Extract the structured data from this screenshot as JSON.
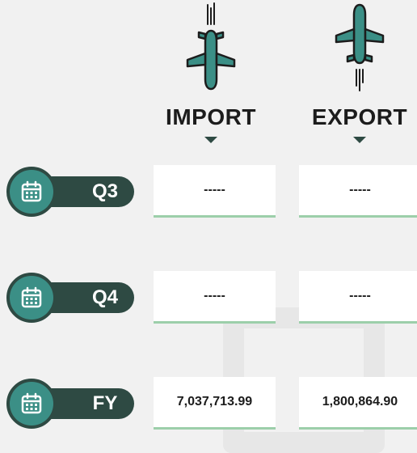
{
  "columns": [
    {
      "label": "IMPORT",
      "icon": "plane-landing-icon"
    },
    {
      "label": "EXPORT",
      "icon": "plane-takeoff-icon"
    }
  ],
  "rows": [
    {
      "label": "Q3",
      "icon": "calendar-icon",
      "import": "-----",
      "export": "-----"
    },
    {
      "label": "Q4",
      "icon": "calendar-icon",
      "import": "-----",
      "export": "-----"
    },
    {
      "label": "FY",
      "icon": "calendar-icon",
      "import": "7,037,713.99",
      "export": "1,800,864.90"
    }
  ],
  "colors": {
    "accent": "#3b8f86",
    "dark": "#2e4a43",
    "underline": "#9ccfaa",
    "background": "#f1f1f1"
  }
}
